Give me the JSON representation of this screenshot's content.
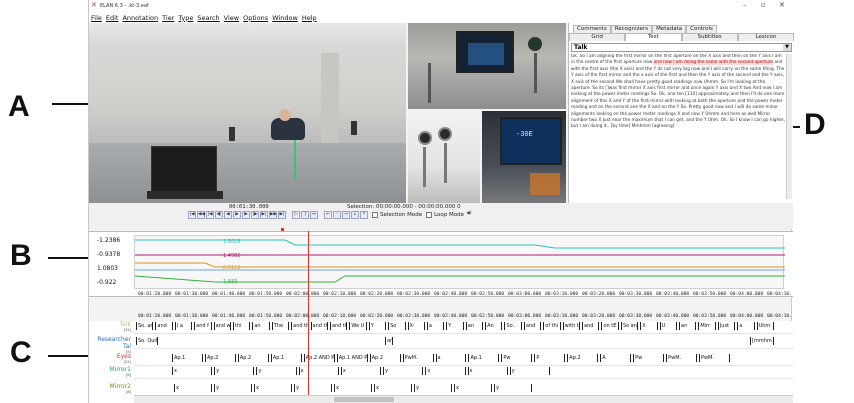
{
  "callouts": {
    "a": "A",
    "b": "B",
    "c": "C",
    "d": "D"
  },
  "window": {
    "title": "ELAN 6.3 - .kt-3.eaf"
  },
  "menu": [
    "File",
    "Edit",
    "Annotation",
    "Tier",
    "Type",
    "Search",
    "View",
    "Options",
    "Window",
    "Help"
  ],
  "panel": {
    "tabs_top": [
      "Comments",
      "Recognizers",
      "Metadata",
      "Controls"
    ],
    "tabs_bottom": [
      "Grid",
      "Text",
      "Subtitles",
      "Lexicon"
    ],
    "active_tab": "Text",
    "tier": "Talk",
    "text_before": "Ok. So I am aligning the first mirror on the first aperture on the X axis and then on the Y axis I am in the centre of the first aperture now",
    "text_highlight": "and now I am doing the same with the second aperture",
    "text_after": "and with the first axis (the X axis) and the Y its not very big now and I will carry on the same thing. The Y axis of the first mirror and the x axis of the first and then the Y axis of the second and the Y axis, X axis of the second We shall have pretty good readings now Uhmm. So I'm looking at the aperture. So its []was first mirror X axis first mirror and once again Y axis and X two And now I am looking at the power meter readings So. Ok, one ten [110] approximately and then I'll do one more alignment of this X and Y of the first mirror with looking at both the aperture and the power meter reading and on the second one the X and on the Y So. Pretty good now and I will do some minor alignments looking on the power meter readings X and now Y Uhmm and here as well Mirror number two X Just near the maximum that I can get, and the Y Uhm. Ok. So I know I can go higher, but I am doing it.. [by time] Mmhmm [agreeing]"
  },
  "controls": {
    "time": "00:01:30.000",
    "selection": "Selection: 00:00:00.000 - 00:00:00.000 0",
    "selection_mode": "Selection Mode",
    "loop_mode": "Loop Mode"
  },
  "timeseries": {
    "y_ticks": [
      "-1.2386",
      "-0.9378",
      "1.0803",
      "-0.922"
    ],
    "value_labels": [
      "1.3015",
      "1.4986",
      "0.0112",
      "1.933"
    ],
    "colors": [
      "#27c4b8",
      "#b21e72",
      "#d69a22",
      "#33b33d",
      "#6fa5de"
    ]
  },
  "ruler_ticks": [
    "00:01:20.000",
    "00:01:30.000",
    "00:01:40.000",
    "00:01:50.000",
    "00:02:00.000",
    "00:02:10.000",
    "00:02:20.000",
    "00:02:30.000",
    "00:02:40.000",
    "00:02:50.000",
    "00:03:00.000",
    "00:03:10.000",
    "00:03:20.000",
    "00:03:30.000",
    "00:03:40.000",
    "00:03:50.000",
    "00:04:00.000",
    "00:04:10."
  ],
  "tiers": [
    {
      "name": "Talk",
      "count": "[35]",
      "color": "#d4b878"
    },
    {
      "name": "Researcher Tal",
      "count": "[6]",
      "color": "#2e6fc2"
    },
    {
      "name": "Eyes",
      "count": "[25]",
      "color": "#d03030"
    },
    {
      "name": "Mirror1",
      "count": "[6]",
      "color": "#1fa37a"
    },
    {
      "name": "Mirror2",
      "count": "[8]",
      "color": "#7c8a1a"
    }
  ],
  "annotations": {
    "talk": [
      "So. am",
      "and",
      "I a",
      "and f",
      "and wit",
      "thi",
      "an",
      "The",
      "and th",
      "and th",
      "and th",
      "We U",
      "Y",
      "So",
      "X-",
      "a",
      "Y",
      "an",
      "An",
      "So.",
      "and",
      "of thi",
      "with t",
      "and",
      "on tE",
      "So and",
      "X",
      "U",
      "an",
      "Mirr",
      "Just",
      "a",
      "Uhm. O"
    ],
    "researcher": [
      "So. Quit",
      "an",
      "[mmhm"
    ],
    "eyes": [
      "Ap.1",
      "Ap.2",
      "Ap.2",
      "Ap.1",
      "Ap.2 AND PwM",
      "Ap.1 AND PwM. brief",
      "Ap.2",
      "PwM.",
      "a",
      "Ap.1",
      "Pw",
      "P",
      "Ap.2",
      "A",
      "Pw",
      "PwM.",
      "PwM."
    ],
    "mirror1": [
      "x",
      "y",
      "y",
      "x",
      "x",
      "y",
      "x",
      "x",
      "y"
    ],
    "mirror2": [
      "x",
      "y",
      "x",
      "y",
      "x",
      "x",
      "y",
      "x",
      "y"
    ]
  }
}
